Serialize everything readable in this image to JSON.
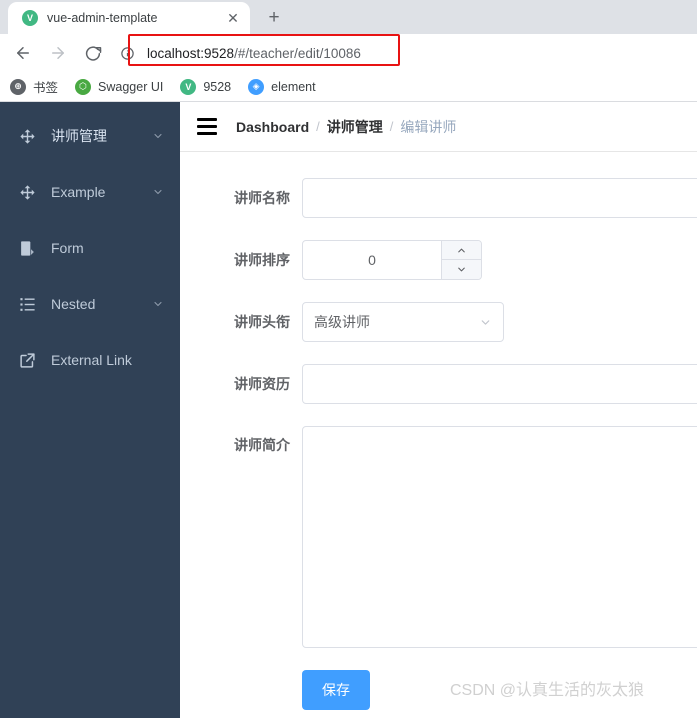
{
  "browser": {
    "tab": {
      "title": "vue-admin-template",
      "favicon_letter": "V",
      "favicon_color": "#41b883",
      "close_label": "✕"
    },
    "new_tab_label": "+",
    "nav": {
      "back_icon": "arrow-left-icon",
      "forward_icon": "arrow-right-icon",
      "reload_icon": "reload-icon"
    },
    "omnibox": {
      "info_icon": "site-info-icon",
      "host": "localhost:9528",
      "path": "/#/teacher/edit/10086",
      "full_url": "localhost:9528/#/teacher/edit/10086",
      "highlight_color": "#e81313"
    },
    "bookmarks": [
      {
        "label": "书签",
        "icon": "globe-icon",
        "color": "#5f6368",
        "glyph": "⊕"
      },
      {
        "label": "Swagger UI",
        "icon": "swagger-icon",
        "color": "#49a942",
        "glyph": "⬡"
      },
      {
        "label": "9528",
        "icon": "vue-icon",
        "color": "#41b883",
        "glyph": "V"
      },
      {
        "label": "element",
        "icon": "element-icon",
        "color": "#409eff",
        "glyph": "◈"
      }
    ]
  },
  "sidebar": {
    "background": "#304156",
    "items": [
      {
        "label": "讲师管理",
        "icon": "component-icon",
        "has_arrow": true,
        "active": true
      },
      {
        "label": "Example",
        "icon": "component-icon",
        "has_arrow": true,
        "active": false
      },
      {
        "label": "Form",
        "icon": "form-icon",
        "has_arrow": false,
        "active": false
      },
      {
        "label": "Nested",
        "icon": "nested-list-icon",
        "has_arrow": true,
        "active": false
      },
      {
        "label": "External Link",
        "icon": "external-link-icon",
        "has_arrow": false,
        "active": false
      }
    ]
  },
  "navbar": {
    "hamburger_icon": "hamburger-menu-icon",
    "breadcrumb": [
      {
        "label": "Dashboard"
      },
      {
        "label": "讲师管理"
      },
      {
        "label": "编辑讲师"
      }
    ],
    "separator": "/"
  },
  "form": {
    "fields": {
      "name": {
        "label": "讲师名称",
        "value": "",
        "placeholder": ""
      },
      "sort": {
        "label": "讲师排序",
        "value": "0",
        "increase_icon": "chevron-up-icon",
        "decrease_icon": "chevron-down-icon"
      },
      "title": {
        "label": "讲师头衔",
        "value": "高级讲师",
        "arrow_icon": "chevron-down-icon"
      },
      "career": {
        "label": "讲师资历",
        "value": "",
        "placeholder": ""
      },
      "intro": {
        "label": "讲师简介",
        "value": "",
        "placeholder": ""
      }
    },
    "save_button": {
      "label": "保存",
      "color": "#409eff"
    }
  },
  "watermark": {
    "text": "CSDN @认真生活的灰太狼"
  }
}
